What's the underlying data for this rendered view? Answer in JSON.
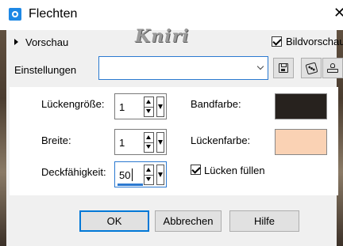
{
  "window": {
    "title": "Flechten",
    "close_glyph": "✕",
    "icon": "camera-icon"
  },
  "preview": {
    "label": "Vorschau",
    "bild_label": "Bildvorschau",
    "bild_checked": true
  },
  "watermark": "Kniri",
  "settings": {
    "label": "Einstellungen",
    "value": "",
    "icons": [
      "save-icon",
      "dice-icon",
      "stamp-icon"
    ]
  },
  "fields": {
    "gap_size": {
      "label": "Lückengröße:",
      "value": "1"
    },
    "width": {
      "label": "Breite:",
      "value": "1"
    },
    "opacity": {
      "label": "Deckfähigkeit:",
      "value": "50"
    }
  },
  "colors": {
    "ribbon": {
      "label": "Bandfarbe:",
      "value": "#27221e"
    },
    "gap": {
      "label": "Lückenfarbe:",
      "value": "#fad2b4"
    }
  },
  "fill_gaps": {
    "label": "Lücken füllen",
    "checked": true
  },
  "buttons": {
    "ok": "OK",
    "cancel": "Abbrechen",
    "help": "Hilfe"
  },
  "accent": "#0078d7"
}
